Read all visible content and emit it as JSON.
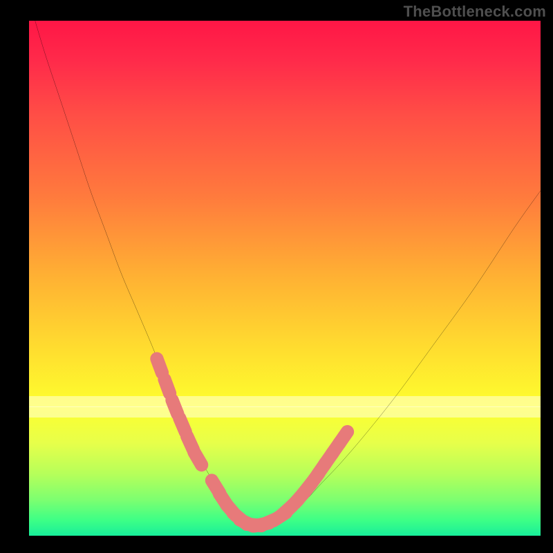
{
  "watermark": "TheBottleneck.com",
  "colors": {
    "black": "#000000",
    "curve_stroke": "#000000",
    "marker_fill": "#e77a7a",
    "marker_stroke": "#e77a7a",
    "pale_band": "rgba(255,255,210,0.55)"
  },
  "chart_data": {
    "type": "line",
    "title": "",
    "xlabel": "",
    "ylabel": "",
    "xlim": [
      0,
      100
    ],
    "ylim": [
      0,
      100
    ],
    "grid": false,
    "legend": false,
    "note": "x and y are percentages of the plot area (0,0 = top-left). The curve is a V-shaped bottleneck-style plot. Values are estimated from pixel positions.",
    "series": [
      {
        "name": "bottleneck-curve",
        "x": [
          0,
          3,
          6,
          9,
          12,
          15,
          18,
          21,
          24,
          26,
          28,
          30,
          32,
          34,
          36,
          38,
          40,
          41.5,
          43,
          45,
          48,
          51,
          54,
          57,
          61,
          66,
          72,
          79,
          87,
          95,
          100
        ],
        "y": [
          -4,
          6,
          15,
          24,
          33,
          41,
          49,
          56,
          63,
          68,
          73,
          77.5,
          82,
          86,
          89.5,
          92.5,
          95,
          96.8,
          97.8,
          97.9,
          97.2,
          95.6,
          93.2,
          90,
          85.8,
          80,
          72.5,
          63,
          52,
          40,
          33
        ]
      }
    ],
    "markers": {
      "name": "highlighted-points",
      "note": "Salmon pill-shaped markers on portions of the curve near the trough and on the approaches.",
      "points": [
        {
          "x": 25.5,
          "y": 67
        },
        {
          "x": 27.0,
          "y": 71
        },
        {
          "x": 28.5,
          "y": 75
        },
        {
          "x": 30.0,
          "y": 78.5
        },
        {
          "x": 31.5,
          "y": 82
        },
        {
          "x": 33.0,
          "y": 85
        },
        {
          "x": 36.5,
          "y": 90.5
        },
        {
          "x": 38.0,
          "y": 93
        },
        {
          "x": 39.5,
          "y": 95
        },
        {
          "x": 41.0,
          "y": 96.5
        },
        {
          "x": 42.5,
          "y": 97.5
        },
        {
          "x": 44.0,
          "y": 97.9
        },
        {
          "x": 45.5,
          "y": 97.8
        },
        {
          "x": 47.0,
          "y": 97.3
        },
        {
          "x": 49.0,
          "y": 96.3
        },
        {
          "x": 50.3,
          "y": 95.2
        },
        {
          "x": 51.6,
          "y": 94.0
        },
        {
          "x": 53.0,
          "y": 92.5
        },
        {
          "x": 54.4,
          "y": 90.8
        },
        {
          "x": 55.8,
          "y": 89.0
        },
        {
          "x": 57.2,
          "y": 87.0
        },
        {
          "x": 58.6,
          "y": 85.0
        },
        {
          "x": 60.0,
          "y": 83.0
        },
        {
          "x": 61.4,
          "y": 81.0
        }
      ]
    },
    "pale_bands_y": [
      74,
      76
    ]
  }
}
